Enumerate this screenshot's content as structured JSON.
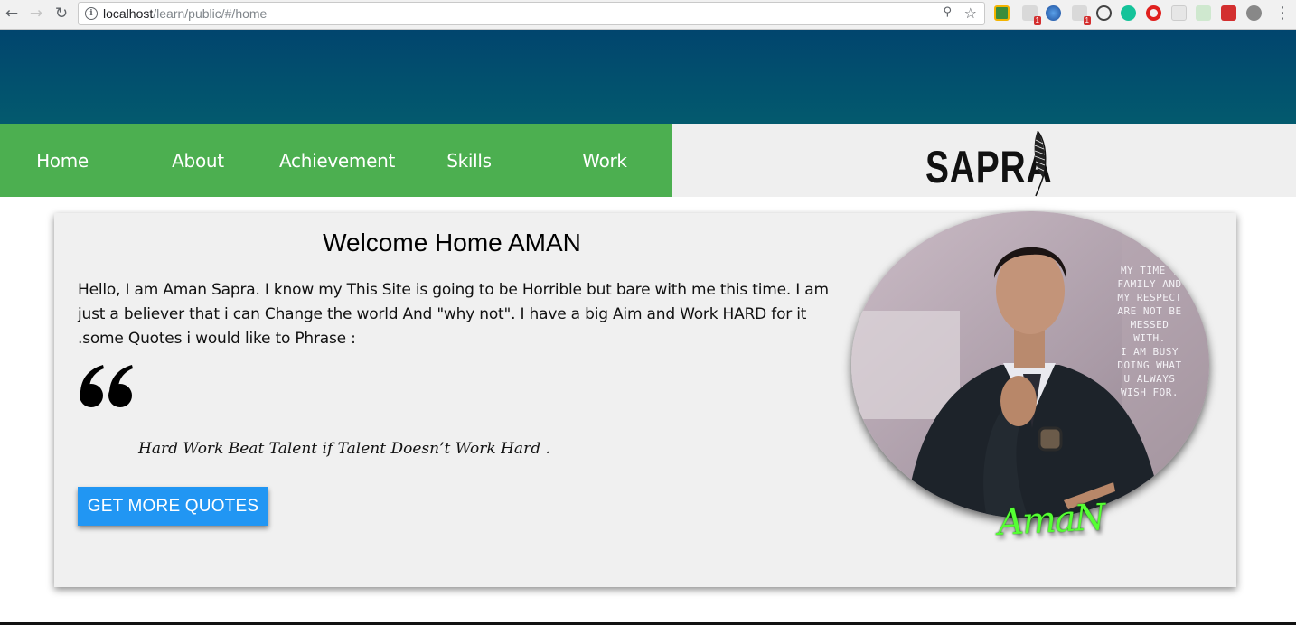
{
  "browser": {
    "url_host": "localhost",
    "url_path": "/learn/public/#/home",
    "back_icon": "arrow-left-icon",
    "forward_icon": "arrow-right-icon",
    "reload_icon": "reload-icon",
    "extension_badges": [
      "1",
      "1"
    ]
  },
  "nav": {
    "items": [
      {
        "label": "Home"
      },
      {
        "label": "About"
      },
      {
        "label": "Achievement"
      },
      {
        "label": "Skills"
      },
      {
        "label": "Work"
      }
    ],
    "color": "#4caf50"
  },
  "brand": {
    "logo_text": "SAPRA"
  },
  "header": {
    "color_top": "#01456e",
    "color_bottom": "#035a6e"
  },
  "main": {
    "title": "Welcome Home AMAN",
    "intro": "Hello, I am Aman Sapra. I know my This Site is going to be Horrible but bare with me this time. I am just a believer that i can Change the world And \"why not\". I have a big Aim and Work HARD for it .some Quotes i would like to Phrase :",
    "quote": "Hard Work Beat Talent if Talent Doesn’t Work Hard .",
    "button_label": "GET MORE QUOTES",
    "button_color": "#2196f3"
  },
  "profile": {
    "photo_text": [
      "MY TIME ,",
      "FAMILY AND",
      "MY RESPECT",
      "ARE NOT BE",
      "MESSED",
      "WITH.",
      "I AM BUSY",
      "DOING WHAT",
      "U ALWAYS",
      "WISH FOR."
    ],
    "caption": "AmaN"
  }
}
